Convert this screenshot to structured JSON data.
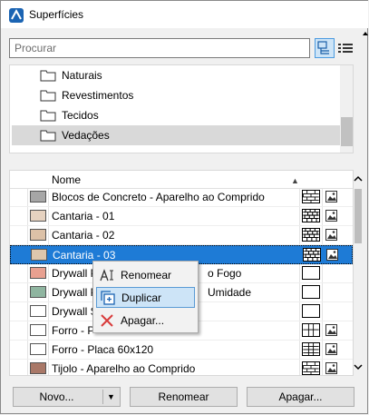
{
  "window": {
    "title": "Superfícies"
  },
  "search": {
    "placeholder": "Procurar"
  },
  "tree": {
    "items": [
      {
        "label": "Naturais",
        "selected": false
      },
      {
        "label": "Revestimentos",
        "selected": false
      },
      {
        "label": "Tecidos",
        "selected": false
      },
      {
        "label": "Vedações",
        "selected": true
      }
    ]
  },
  "grid": {
    "header": {
      "name": "Nome"
    },
    "rows": [
      {
        "name": "Blocos de Concreto - Aparelho ao Comprido",
        "color": "#a6a6a6",
        "pattern": "brick",
        "has_preview": true
      },
      {
        "name": "Cantaria - 01",
        "color": "#e6d2c0",
        "pattern": "stone",
        "has_preview": true
      },
      {
        "name": "Cantaria - 02",
        "color": "#dcc1a7",
        "pattern": "stone",
        "has_preview": true
      },
      {
        "name": "Cantaria - 03",
        "color": "#ddc7ad",
        "pattern": "stone",
        "has_preview": true,
        "selected": true
      },
      {
        "name": "Drywall Placa Resistente ao Fogo",
        "color": "#e8a090",
        "pattern": "none",
        "has_preview": false
      },
      {
        "name": "Drywall Placa Resistente à Umidade",
        "color": "#8fb5a0",
        "pattern": "none",
        "has_preview": false
      },
      {
        "name": "Drywall Standard",
        "color": "#ffffff",
        "pattern": "none",
        "has_preview": false
      },
      {
        "name": "Forro - Placa 60x60",
        "color": "#ffffff",
        "pattern": "grid-large",
        "has_preview": true
      },
      {
        "name": "Forro - Placa 60x120",
        "color": "#ffffff",
        "pattern": "grid-wide",
        "has_preview": true
      },
      {
        "name": "Tijolo - Aparelho ao Comprido",
        "color": "#a97868",
        "pattern": "brick",
        "has_preview": true
      }
    ],
    "visible_names": [
      "Blocos de Concreto - Aparelho ao Comprido",
      "Cantaria - 01",
      "Cantaria - 02",
      "Cantaria - 03",
      "Drywall P",
      "Drywall P",
      "Drywall S",
      "Forro - P",
      "Forro - Placa 60x120",
      "Tijolo - Aparelho ao Comprido"
    ],
    "visible_tails": {
      "4": "o Fogo",
      "5": "Umidade"
    }
  },
  "context_menu": {
    "items": [
      {
        "label": "Renomear",
        "icon": "rename-icon",
        "highlighted": false
      },
      {
        "label": "Duplicar",
        "icon": "duplicate-icon",
        "highlighted": true
      },
      {
        "label": "Apagar...",
        "icon": "delete-icon",
        "highlighted": false
      }
    ]
  },
  "buttons": {
    "new": "Novo...",
    "rename": "Renomear",
    "delete": "Apagar..."
  },
  "colors": {
    "selection": "#1e7bd6",
    "menu_highlight": "#cde4f7",
    "delete_red": "#d83b3b"
  }
}
